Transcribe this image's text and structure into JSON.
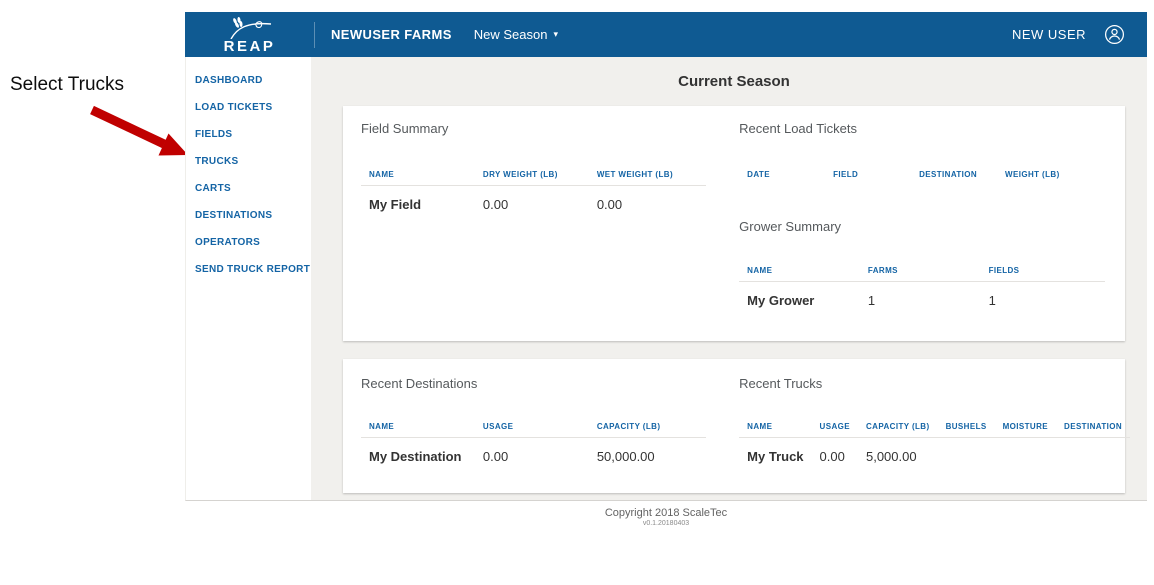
{
  "annotation": {
    "label": "Select Trucks"
  },
  "navbar": {
    "brand": "REAP",
    "farm_name": "NEWUSER FARMS",
    "season_dropdown": "New Season",
    "season_caret_glyph": "▾",
    "user_name": "NEW USER"
  },
  "icons": {
    "brand_icon": "wheat-icon",
    "season_caret": "caret-down-icon",
    "user_icon": "user-circle-icon"
  },
  "colors": {
    "navbar_bg": "#0F5A92",
    "link_blue": "#1464A5",
    "content_bg": "#F1F0ED",
    "annotation_arrow_red": "#C00000"
  },
  "sidebar": {
    "items": [
      "DASHBOARD",
      "LOAD TICKETS",
      "FIELDS",
      "TRUCKS",
      "CARTS",
      "DESTINATIONS",
      "OPERATORS",
      "SEND TRUCK REPORT"
    ]
  },
  "main": {
    "title": "Current Season",
    "field_summary": {
      "title": "Field Summary",
      "headers": [
        "NAME",
        "DRY WEIGHT (LB)",
        "WET WEIGHT (LB)"
      ],
      "rows": [
        [
          "My Field",
          "0.00",
          "0.00"
        ]
      ]
    },
    "recent_load_tickets": {
      "title": "Recent Load Tickets",
      "headers": [
        "DATE",
        "FIELD",
        "DESTINATION",
        "WEIGHT (LB)"
      ],
      "rows": []
    },
    "grower_summary": {
      "title": "Grower Summary",
      "headers": [
        "NAME",
        "FARMS",
        "FIELDS"
      ],
      "rows": [
        [
          "My Grower",
          "1",
          "1"
        ]
      ]
    },
    "recent_destinations": {
      "title": "Recent Destinations",
      "headers": [
        "NAME",
        "USAGE",
        "CAPACITY (LB)"
      ],
      "rows": [
        [
          "My Destination",
          "0.00",
          "50,000.00"
        ]
      ]
    },
    "recent_trucks": {
      "title": "Recent Trucks",
      "headers": [
        "NAME",
        "USAGE",
        "CAPACITY (LB)",
        "BUSHELS",
        "MOISTURE",
        "DESTINATION"
      ],
      "rows": [
        [
          "My Truck",
          "0.00",
          "5,000.00",
          "",
          "",
          ""
        ]
      ]
    }
  },
  "footer": {
    "copyright": "Copyright 2018 ScaleTec",
    "version": "v0.1.20180403"
  }
}
